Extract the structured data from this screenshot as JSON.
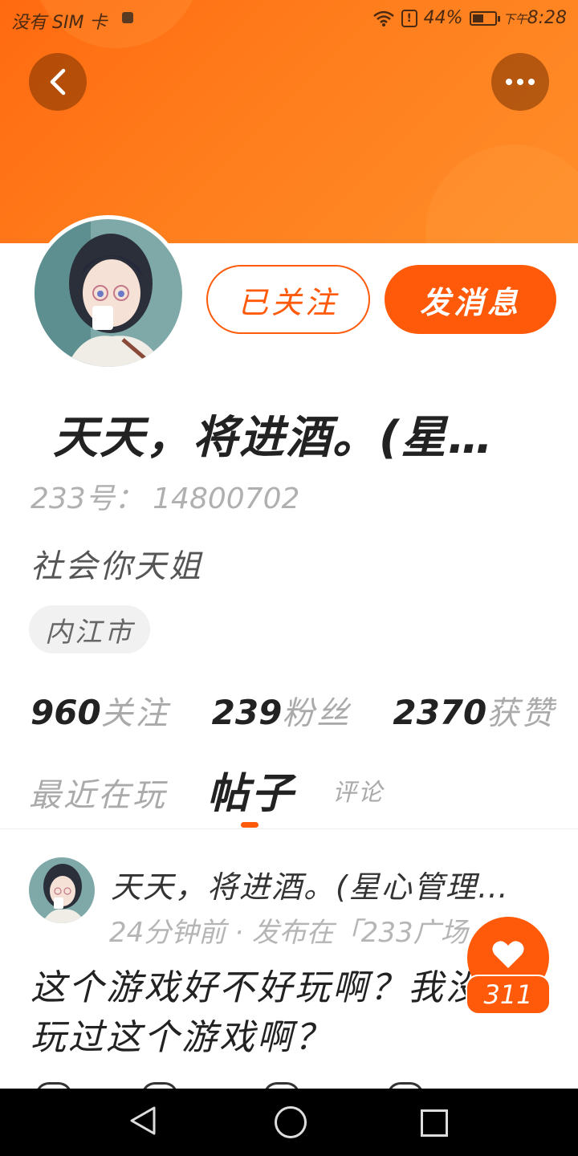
{
  "status_bar": {
    "carrier": "没有 SIM 卡",
    "battery": "44%",
    "time_prefix": "下午",
    "time": "8:28"
  },
  "profile": {
    "nickname": "天天，将进酒。(星…",
    "uid": "233号： 14800702",
    "bio": "社会你天姐",
    "location": "内江市",
    "follow_label": "已关注",
    "message_label": "发消息"
  },
  "stats": [
    {
      "num": "960",
      "label": "关注"
    },
    {
      "num": "239",
      "label": "粉丝"
    },
    {
      "num": "2370",
      "label": "获赞"
    }
  ],
  "tabs": {
    "recent": "最近在玩",
    "posts": "帖子",
    "comments": "评论"
  },
  "post": {
    "author": "天天，将进酒。(星心管理…",
    "meta": "24分钟前 · 发布在「233广场",
    "body": "这个游戏好不好玩啊？我没有玩过这个游戏啊？"
  },
  "like": {
    "count": "311"
  },
  "colors": {
    "accent": "#ff5a0a",
    "header_start": "#ff6a10",
    "header_end": "#ff8e2a"
  }
}
